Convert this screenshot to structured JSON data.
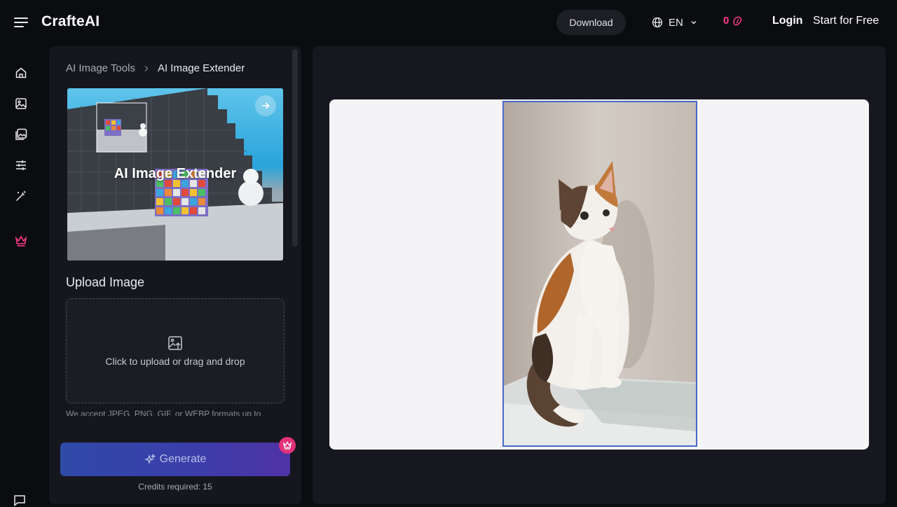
{
  "header": {
    "brand": "CrafteAI",
    "download_label": "Download",
    "language": "EN",
    "credits_count": "0",
    "login_label": "Login",
    "start_label": "Start for Free"
  },
  "sidenav": {
    "items": [
      {
        "icon": "home-icon"
      },
      {
        "icon": "image-icon"
      },
      {
        "icon": "gallery-icon"
      },
      {
        "icon": "sliders-icon"
      },
      {
        "icon": "magic-wand-icon"
      },
      {
        "icon": "crown-icon"
      }
    ],
    "feedback_icon": "chat-icon"
  },
  "panel": {
    "breadcrumb": [
      "AI Image Tools",
      "AI Image Extender"
    ],
    "hero_title": "AI Image Extender",
    "upload_title": "Upload Image",
    "upload_hint": "Click to upload or drag and drop",
    "accept_note": "We accept JPEG, PNG, GIF, or WEBP formats up to",
    "generate_label": "Generate",
    "credits_required": "Credits required: 15"
  },
  "colors": {
    "accent_pink": "#ff3d8b",
    "generate_start": "#2f4aa7",
    "generate_end": "#4f33a4",
    "frame_blue": "#4a67c9"
  }
}
